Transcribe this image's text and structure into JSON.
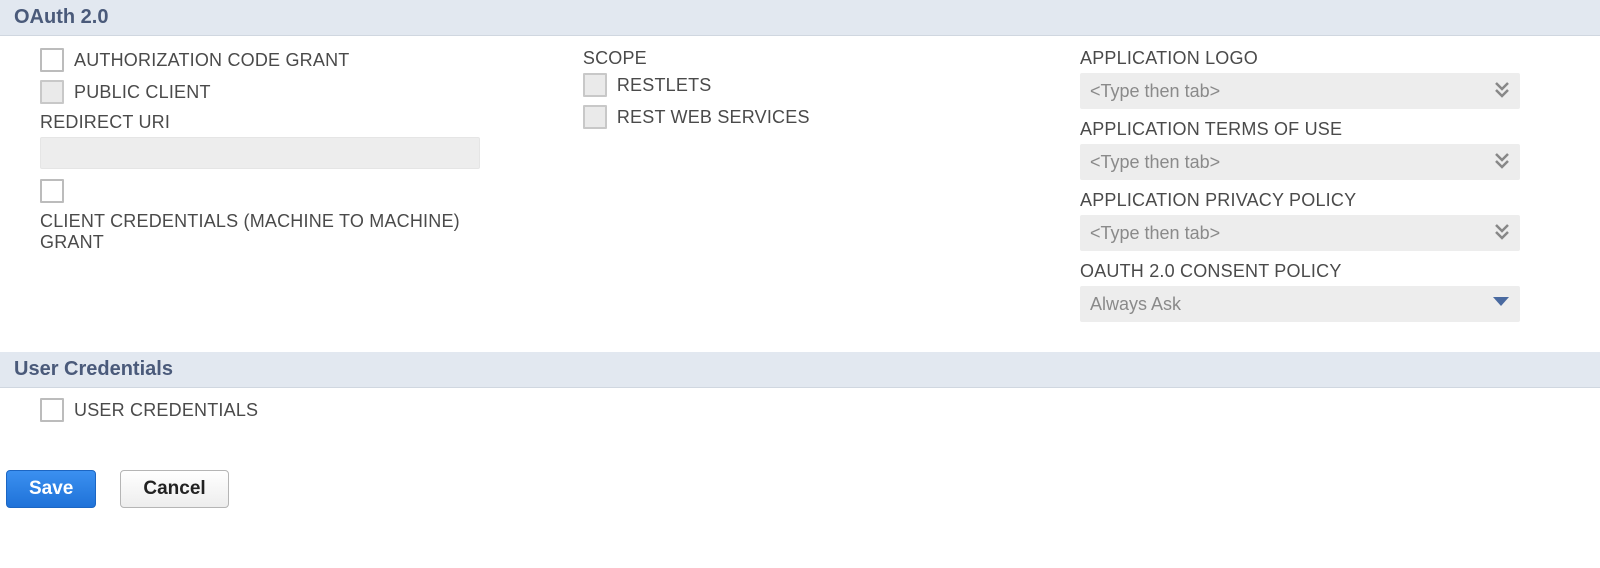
{
  "oauth": {
    "header": "OAuth 2.0",
    "col1": {
      "auth_code_grant_label": "AUTHORIZATION CODE GRANT",
      "public_client_label": "PUBLIC CLIENT",
      "redirect_uri_label": "REDIRECT URI",
      "redirect_uri_value": "",
      "client_credentials_label": "CLIENT CREDENTIALS (MACHINE TO MACHINE) GRANT"
    },
    "col2": {
      "scope_label": "SCOPE",
      "restlets_label": "RESTLETS",
      "rest_web_services_label": "REST WEB SERVICES"
    },
    "col3": {
      "app_logo_label": "APPLICATION LOGO",
      "app_logo_placeholder": "<Type then tab>",
      "app_tou_label": "APPLICATION TERMS OF USE",
      "app_tou_placeholder": "<Type then tab>",
      "app_privacy_label": "APPLICATION PRIVACY POLICY",
      "app_privacy_placeholder": "<Type then tab>",
      "consent_policy_label": "OAUTH 2.0 CONSENT POLICY",
      "consent_policy_value": "Always Ask"
    }
  },
  "user_credentials": {
    "header": "User Credentials",
    "user_credentials_label": "USER CREDENTIALS"
  },
  "buttons": {
    "save": "Save",
    "cancel": "Cancel"
  }
}
